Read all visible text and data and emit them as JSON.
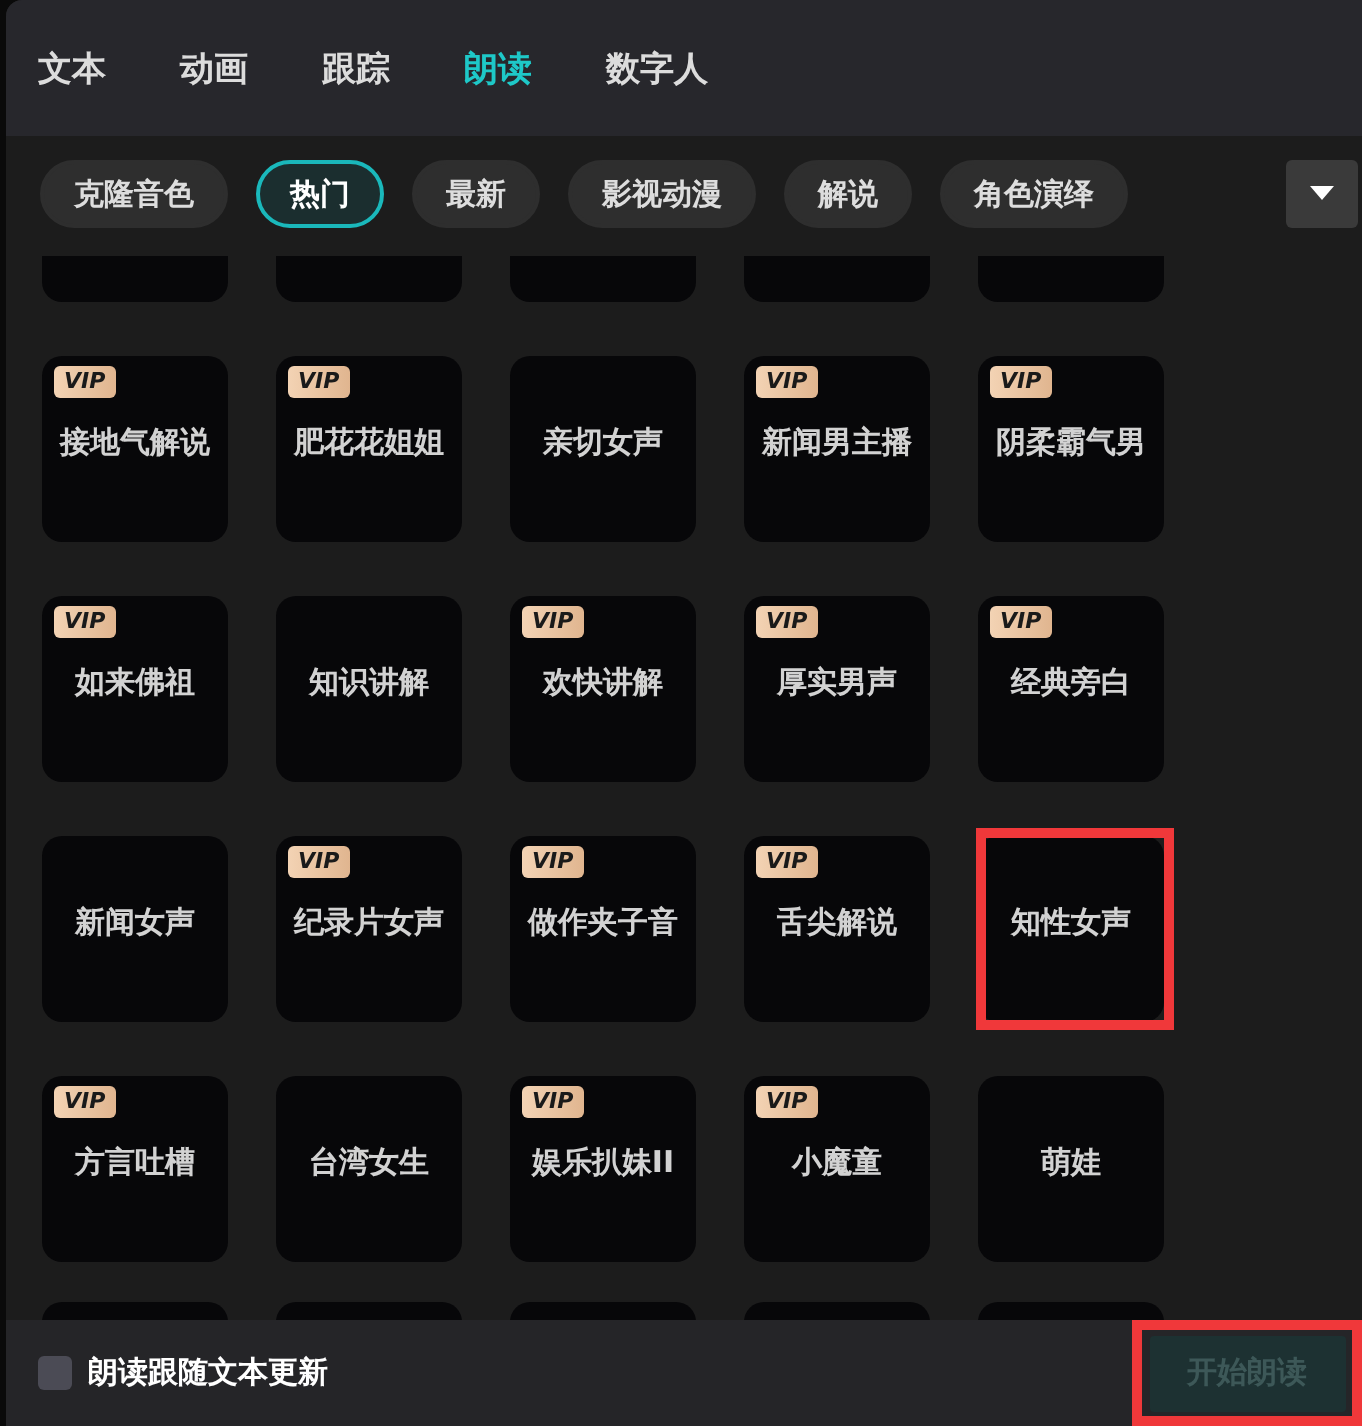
{
  "tabs": [
    {
      "label": "文本",
      "selected": false
    },
    {
      "label": "动画",
      "selected": false
    },
    {
      "label": "跟踪",
      "selected": false
    },
    {
      "label": "朗读",
      "selected": true
    },
    {
      "label": "数字人",
      "selected": false
    }
  ],
  "categories": [
    {
      "label": "克隆音色",
      "selected": false
    },
    {
      "label": "热门",
      "selected": true
    },
    {
      "label": "最新",
      "selected": false
    },
    {
      "label": "影视动漫",
      "selected": false
    },
    {
      "label": "解说",
      "selected": false
    },
    {
      "label": "角色演绎",
      "selected": false
    }
  ],
  "voices": [
    {
      "name": "接地气解说",
      "badge": "VIP",
      "highlighted": false
    },
    {
      "name": "肥花花姐姐",
      "badge": "VIP",
      "highlighted": false
    },
    {
      "name": "亲切女声",
      "highlighted": false
    },
    {
      "name": "新闻男主播",
      "badge": "VIP",
      "highlighted": false
    },
    {
      "name": "阴柔霸气男",
      "badge": "VIP",
      "highlighted": false
    },
    {
      "name": "如来佛祖",
      "badge": "VIP",
      "highlighted": false
    },
    {
      "name": "知识讲解",
      "highlighted": false
    },
    {
      "name": "欢快讲解",
      "badge": "VIP",
      "highlighted": false
    },
    {
      "name": "厚实男声",
      "badge": "VIP",
      "highlighted": false
    },
    {
      "name": "经典旁白",
      "badge": "VIP",
      "highlighted": false
    },
    {
      "name": "新闻女声",
      "highlighted": false
    },
    {
      "name": "纪录片女声",
      "badge": "VIP",
      "highlighted": false
    },
    {
      "name": "做作夹子音",
      "badge": "VIP",
      "highlighted": false
    },
    {
      "name": "舌尖解说",
      "badge": "VIP",
      "highlighted": false
    },
    {
      "name": "知性女声",
      "highlighted": true
    },
    {
      "name": "方言吐槽",
      "badge": "VIP",
      "highlighted": false
    },
    {
      "name": "台湾女生",
      "highlighted": false
    },
    {
      "name": "娱乐扒妹II",
      "badge": "VIP",
      "highlighted": false
    },
    {
      "name": "小魔童",
      "badge": "VIP",
      "highlighted": false
    },
    {
      "name": "萌娃",
      "highlighted": false
    }
  ],
  "follow_text": {
    "label": "朗读跟随文本更新",
    "checked": false
  },
  "start_button": {
    "label": "开始朗读",
    "disabled": true,
    "highlighted": true
  }
}
